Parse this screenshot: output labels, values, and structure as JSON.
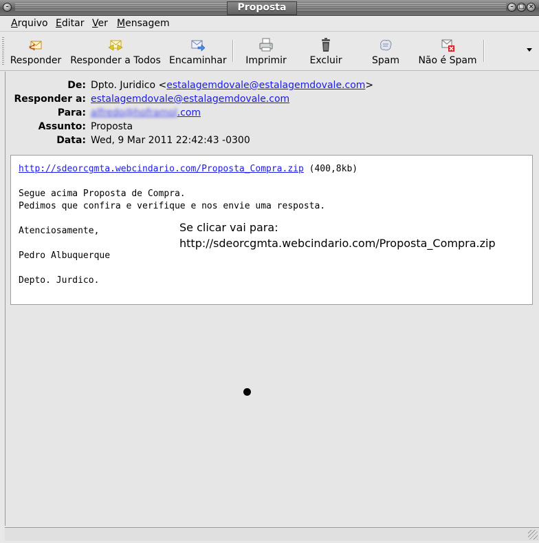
{
  "window": {
    "title": "Proposta"
  },
  "menu": [
    {
      "label": "Arquivo",
      "accel": "A",
      "rest": "rquivo"
    },
    {
      "label": "Editar",
      "accel": "E",
      "rest": "ditar"
    },
    {
      "label": "Ver",
      "accel": "V",
      "rest": "er"
    },
    {
      "label": "Mensagem",
      "accel": "M",
      "rest": "ensagem"
    }
  ],
  "toolbar": {
    "reply": "Responder",
    "reply_all": "Responder a Todos",
    "forward": "Encaminhar",
    "print": "Imprimir",
    "delete": "Excluir",
    "spam": "Spam",
    "not_spam": "Não é Spam"
  },
  "headers": {
    "from_label": "De:",
    "from_name": "Dpto. Juridico <",
    "from_email": "estalagemdovale@estalagemdovale.com",
    "from_close": ">",
    "reply_to_label": "Responder a:",
    "reply_to_email": "estalagemdovale@estalagemdovale.com",
    "to_label": "Para:",
    "to_email_hidden": "alfredo@hoframol",
    "to_email_suffix": ".com",
    "subject_label": "Assunto:",
    "subject": "Proposta",
    "date_label": "Data:",
    "date": "Wed, 9 Mar 2011 22:42:43 -0300"
  },
  "message": {
    "link": "http://sdeorcgmta.webcindario.com/Proposta_Compra.zip",
    "size": " (400,8kb)",
    "line1": "Segue acima Proposta de Compra.",
    "line2": "Pedimos que confira e verifique e nos envie uma resposta.",
    "line3": "Atenciosamente,",
    "line4": "Pedro Albuquerque",
    "line5": "Depto. Jurdico."
  },
  "annotation": {
    "line1": "Se clicar vai para:",
    "line2": "http://sdeorcgmta.webcindario.com/Proposta_Compra.zip"
  },
  "colors": {
    "link": "#1a1aee",
    "body_bg": "#ffffff",
    "chrome_bg": "#e8e8e8"
  }
}
